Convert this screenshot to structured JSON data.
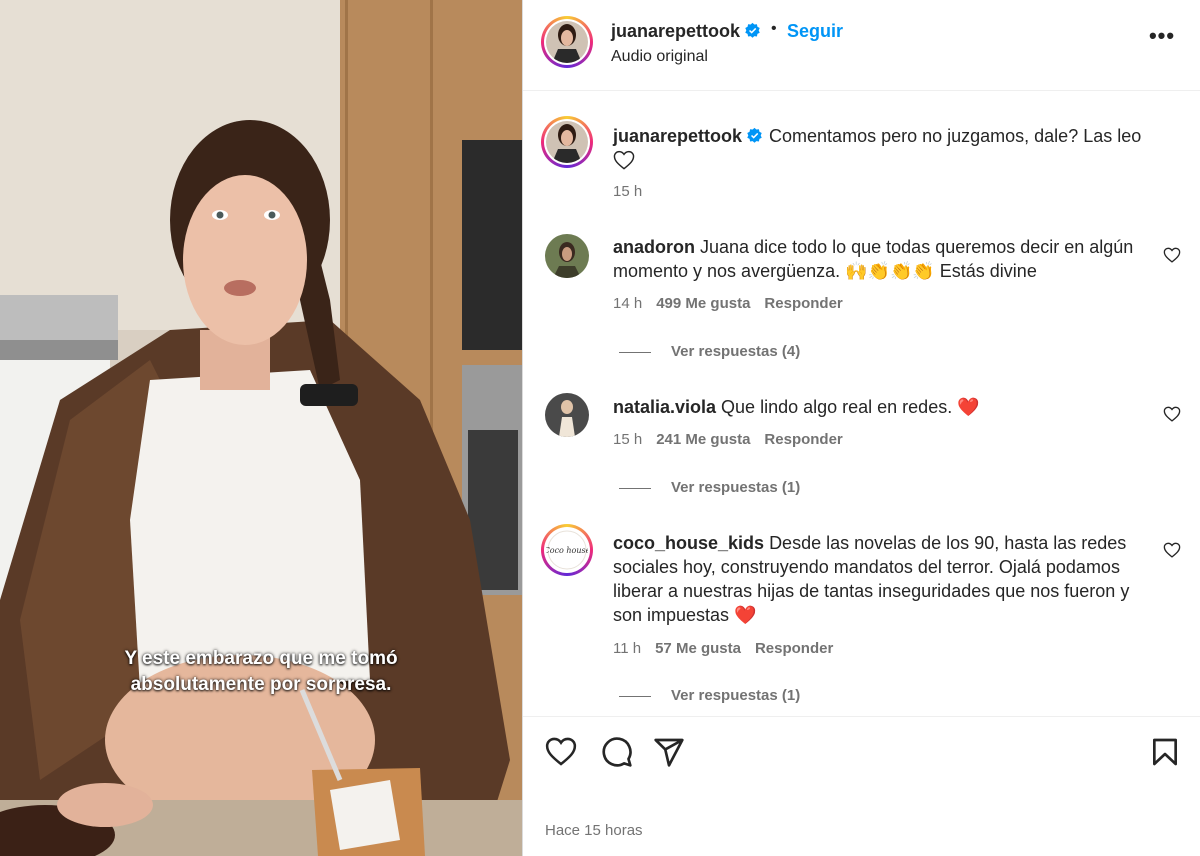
{
  "video": {
    "caption_line1": "Y este embarazo que me tomó",
    "caption_line2": "absolutamente por sorpresa."
  },
  "header": {
    "username": "juanarepettook",
    "separator": "•",
    "follow_label": "Seguir",
    "audio_label": "Audio original",
    "more_label": "•••"
  },
  "post_caption": {
    "username": "juanarepettook",
    "text": "Comentamos pero no juzgamos, dale? Las leo",
    "time": "15 h"
  },
  "comments": [
    {
      "username": "anadoron",
      "text": "Juana dice todo lo que todas queremos decir en algún momento y nos avergüenza. 🙌👏👏👏 Estás divine",
      "time": "14 h",
      "likes": "499 Me gusta",
      "reply_label": "Responder",
      "view_replies": "Ver respuestas (4)"
    },
    {
      "username": "natalia.viola",
      "text": "Que lindo algo real en redes. ❤️",
      "time": "15 h",
      "likes": "241 Me gusta",
      "reply_label": "Responder",
      "view_replies": "Ver respuestas (1)"
    },
    {
      "username": "coco_house_kids",
      "text": "Desde las novelas de los 90, hasta las redes sociales hoy, construyendo mandatos del terror. Ojalá podamos liberar a nuestras hijas de tantas inseguridades que nos fueron y son impuestas ❤️",
      "time": "11 h",
      "likes": "57 Me gusta",
      "reply_label": "Responder",
      "view_replies": "Ver respuestas (1)",
      "avatar_logo_text": "Coco house"
    }
  ],
  "footer": {
    "posted_ago": "Hace 15 horas"
  },
  "colors": {
    "accent": "#0095f6",
    "text": "#262626",
    "muted": "#737373",
    "heart_red": "#e0245e"
  },
  "icons": [
    "verified-badge-icon",
    "heart-icon",
    "comment-icon",
    "share-icon",
    "bookmark-icon",
    "more-options-icon"
  ]
}
